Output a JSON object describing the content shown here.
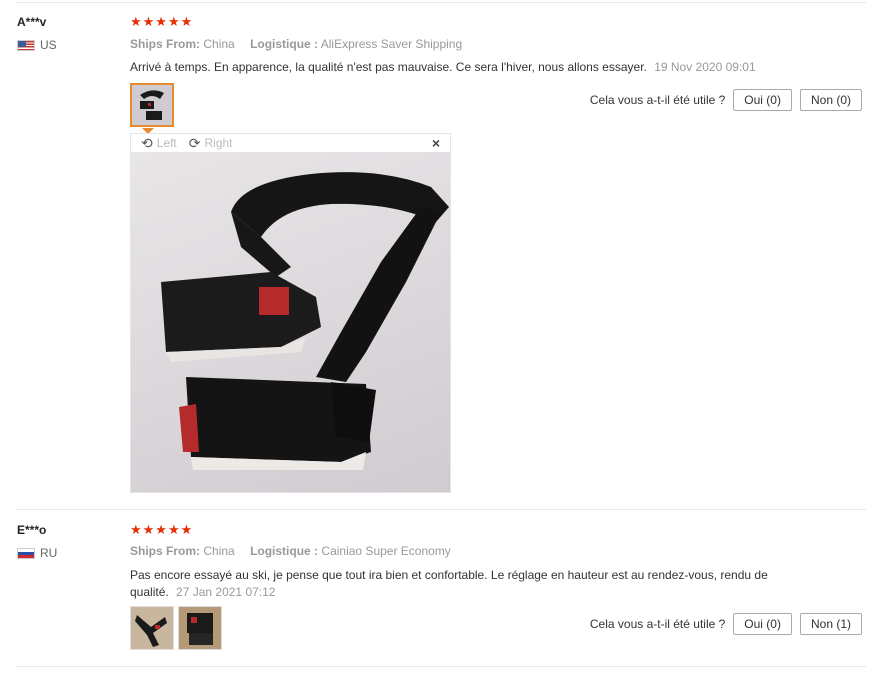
{
  "helpful_label": "Cela vous a-t-il été utile ?",
  "ships_from_label": "Ships From:",
  "logistics_label": "Logistique :",
  "stars_full": "★★★★★",
  "viewer": {
    "left_label": "Left",
    "right_label": "Right",
    "close_glyph": "×",
    "rotate_left_glyph": "⟲",
    "rotate_right_glyph": "⟳"
  },
  "reviews": [
    {
      "user": "A***v",
      "country": "US",
      "rating": 5,
      "ships_from": "China",
      "logistics": "AliExpress Saver Shipping",
      "text": "Arrivé à temps. En apparence, la qualité n'est pas mauvaise. Ce sera l'hiver, nous allons essayer.",
      "date": "19 Nov 2020 09:01",
      "yes_label": "Oui (0)",
      "no_label": "Non (0)"
    },
    {
      "user": "E***o",
      "country": "RU",
      "rating": 5,
      "ships_from": "China",
      "logistics": "Cainiao Super Economy",
      "text": "Pas encore essayé au ski, je pense que tout ira bien et confortable. Le réglage en hauteur est au rendez-vous, rendu de qualité.",
      "date": "27 Jan 2021 07:12",
      "yes_label": "Oui (0)",
      "no_label": "Non (1)"
    }
  ],
  "colors": {
    "star": "#e62e04",
    "thumb_active": "#e88b2e"
  }
}
